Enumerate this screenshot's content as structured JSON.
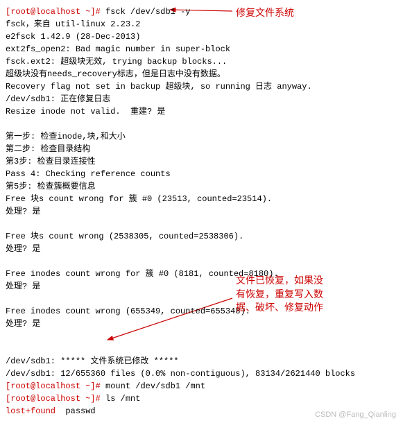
{
  "annotations": {
    "top": "修复文件系统",
    "bottom_l1": "文件已恢复，如果没",
    "bottom_l2": "有恢复，重复写入数",
    "bottom_l3": "据、破坏、修复动作"
  },
  "watermark": "CSDN @Fang_Qianling",
  "term": {
    "p1": "[root@localhost ~]# ",
    "cmd1": "fsck /dev/sdb1 -y",
    "l1": "fsck，来自 util-linux 2.23.2",
    "l2": "e2fsck 1.42.9 (28-Dec-2013)",
    "l3": "ext2fs_open2: Bad magic number in super-block",
    "l4": "fsck.ext2: 超级块无效, trying backup blocks...",
    "l5": "超级块没有needs_recovery标志，但是日志中没有数据。",
    "l6": "Recovery flag not set in backup 超级块, so running 日志 anyway.",
    "l7": "/dev/sdb1: 正在修复日志",
    "l8": "Resize inode not valid.  重建? 是",
    "l9": "",
    "l10": "第一步: 检查inode,块,和大小",
    "l11": "第二步: 检查目录结构",
    "l12": "第3步: 检查目录连接性",
    "l13": "Pass 4: Checking reference counts",
    "l14": "第5步: 检查簇概要信息",
    "l15": "Free 块s count wrong for 簇 #0 (23513, counted=23514).",
    "l16": "处理? 是",
    "l17": "",
    "l18": "Free 块s count wrong (2538305, counted=2538306).",
    "l19": "处理? 是",
    "l20": "",
    "l21": "Free inodes count wrong for 簇 #0 (8181, counted=8180).",
    "l22": "处理? 是",
    "l23": "",
    "l24": "Free inodes count wrong (655349, counted=655348).",
    "l25": "处理? 是",
    "l26": "",
    "l27": "",
    "l28": "/dev/sdb1: ***** 文件系统已修改 *****",
    "l29": "/dev/sdb1: 12/655360 files (0.0% non-contiguous), 83134/2621440 blocks",
    "p2": "[root@localhost ~]# ",
    "cmd2": "mount /dev/sdb1 /mnt",
    "p3": "[root@localhost ~]# ",
    "cmd3": "ls /mnt",
    "out_a": "lost+found",
    "out_b": "  passwd"
  }
}
